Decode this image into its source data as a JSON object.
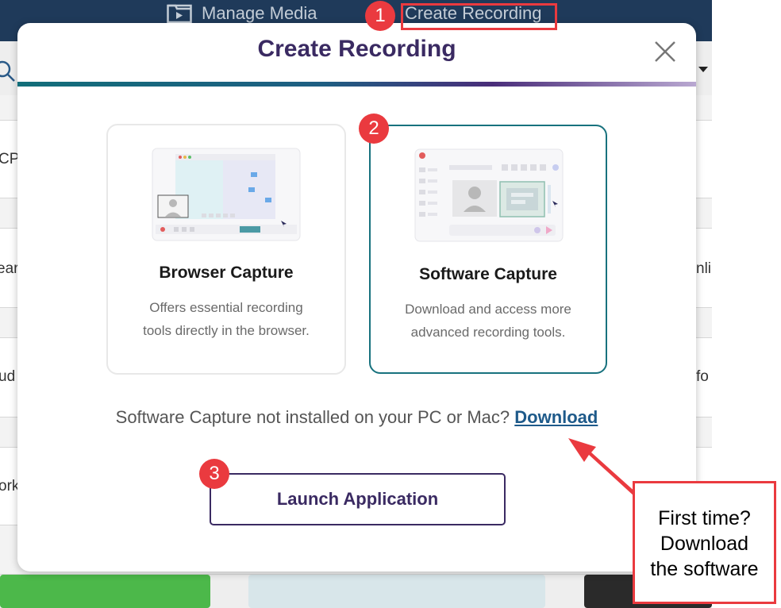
{
  "app": {
    "nav": {
      "manage_media": "Manage Media",
      "create_recording": "Create Recording"
    },
    "background_fragments": [
      "CP",
      "ear",
      "ud",
      "ork",
      "nli",
      "fo"
    ]
  },
  "modal": {
    "title": "Create Recording",
    "cards": [
      {
        "title": "Browser Capture",
        "desc_line1": "Offers essential recording",
        "desc_line2": "tools directly in the browser."
      },
      {
        "title": "Software Capture",
        "desc_line1": "Download and access more",
        "desc_line2": "advanced recording tools."
      }
    ],
    "install_prompt": "Software Capture not installed on your PC or Mac?",
    "download_link": "Download",
    "launch_button": "Launch Application"
  },
  "annotations": {
    "badges": [
      "1",
      "2",
      "3"
    ],
    "callout_line1": "First time?",
    "callout_line2": "Download",
    "callout_line3": "the software",
    "accent_color": "#ea3a3f"
  },
  "colors": {
    "title": "#3a2a62",
    "teal_border": "#18727e",
    "link": "#1e5a8a",
    "topbar": "#1f3a5a"
  }
}
